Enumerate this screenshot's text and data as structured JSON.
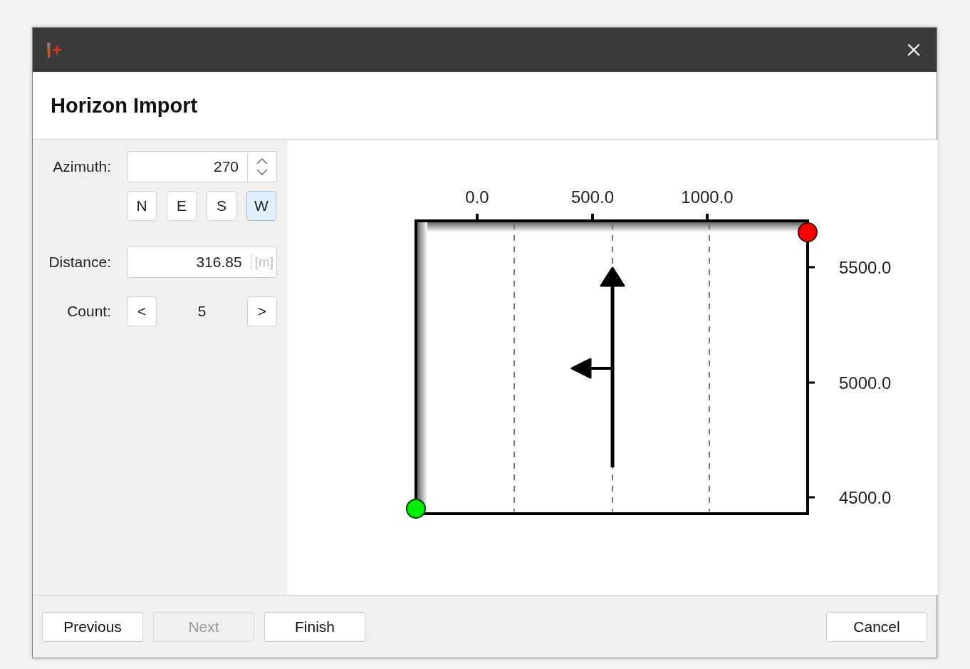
{
  "dialog": {
    "title": "Horizon Import"
  },
  "azimuth": {
    "label": "Azimuth:",
    "value": "270"
  },
  "directions": [
    {
      "label": "N",
      "selected": false
    },
    {
      "label": "E",
      "selected": false
    },
    {
      "label": "S",
      "selected": false
    },
    {
      "label": "W",
      "selected": true
    }
  ],
  "distance": {
    "label": "Distance:",
    "value": "316.85",
    "unit": "[m]"
  },
  "count": {
    "label": "Count:",
    "value": "5",
    "decrement": "<",
    "increment": ">"
  },
  "plot": {
    "x_ticks": [
      "0.0",
      "500.0",
      "1000.0"
    ],
    "y_ticks": [
      "5500.0",
      "5000.0",
      "4500.0"
    ]
  },
  "buttons": [
    {
      "label": "Previous",
      "disabled": false
    },
    {
      "label": "Next",
      "disabled": true
    },
    {
      "label": "Finish",
      "disabled": false
    }
  ],
  "cancel_button": {
    "label": "Cancel"
  }
}
